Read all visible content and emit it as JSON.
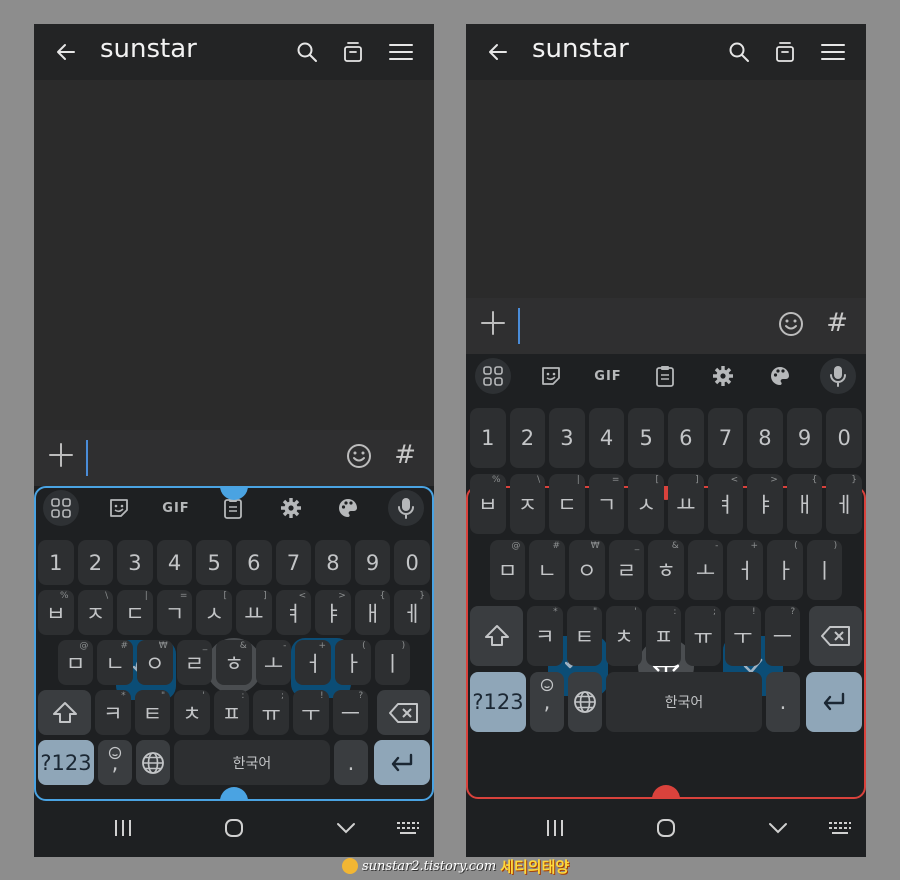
{
  "app": {
    "title": "sunstar"
  },
  "input": {
    "plus": "+",
    "hash": "#"
  },
  "toolbar": {
    "gif": "GIF"
  },
  "keyboard": {
    "digits": [
      "1",
      "2",
      "3",
      "4",
      "5",
      "6",
      "7",
      "8",
      "9",
      "0"
    ],
    "row1": [
      {
        "main": "ㅂ",
        "sup": "%"
      },
      {
        "main": "ㅈ",
        "sup": "\\"
      },
      {
        "main": "ㄷ",
        "sup": "|"
      },
      {
        "main": "ㄱ",
        "sup": "="
      },
      {
        "main": "ㅅ",
        "sup": "["
      },
      {
        "main": "ㅛ",
        "sup": "]"
      },
      {
        "main": "ㅕ",
        "sup": "<"
      },
      {
        "main": "ㅑ",
        "sup": ">"
      },
      {
        "main": "ㅐ",
        "sup": "{"
      },
      {
        "main": "ㅔ",
        "sup": "}"
      }
    ],
    "row2": [
      {
        "main": "ㅁ",
        "sup": "@"
      },
      {
        "main": "ㄴ",
        "sup": "#"
      },
      {
        "main": "ㅇ",
        "sup": "₩"
      },
      {
        "main": "ㄹ",
        "sup": "_"
      },
      {
        "main": "ㅎ",
        "sup": "&"
      },
      {
        "main": "ㅗ",
        "sup": "-"
      },
      {
        "main": "ㅓ",
        "sup": "+"
      },
      {
        "main": "ㅏ",
        "sup": "("
      },
      {
        "main": "ㅣ",
        "sup": ")"
      }
    ],
    "row3": [
      {
        "main": "ㅋ",
        "sup": "*"
      },
      {
        "main": "ㅌ",
        "sup": "\""
      },
      {
        "main": "ㅊ",
        "sup": "'"
      },
      {
        "main": "ㅍ",
        "sup": ":"
      },
      {
        "main": "ㅠ",
        "sup": ";"
      },
      {
        "main": "ㅜ",
        "sup": "!"
      },
      {
        "main": "ㅡ",
        "sup": "?"
      }
    ],
    "symbols_key": "?123",
    "comma_key": ",",
    "space_label": "한국어",
    "period_key": "."
  },
  "colors": {
    "left_frame": "#4aa3e2",
    "right_frame": "#d9423c",
    "accent_button": "#0b4d76"
  },
  "watermark": {
    "site": "sunstar2.tistory.com",
    "brand": "세티의태양"
  }
}
